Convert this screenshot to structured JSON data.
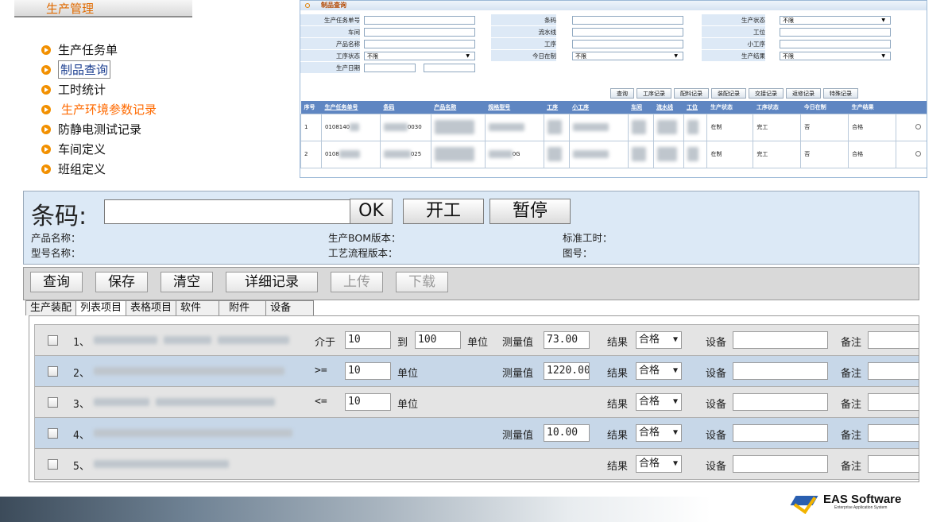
{
  "left_panel": {
    "header": "生产管理",
    "items": [
      {
        "label": "生产任务单"
      },
      {
        "label": "制品查询"
      },
      {
        "label": "工时统计"
      },
      {
        "label": "生产环境参数记录"
      },
      {
        "label": "防静电测试记录"
      },
      {
        "label": "车间定义"
      },
      {
        "label": "班组定义"
      }
    ]
  },
  "query_panel": {
    "title": "制品查询",
    "fields": {
      "task_no": "生产任务单号",
      "workshop": "车间",
      "product_name": "产品名称",
      "process_status": "工序状态",
      "prod_date": "生产日期",
      "barcode": "条码",
      "line": "流水线",
      "process": "工序",
      "today_wip": "今日在制",
      "prod_status": "生产状态",
      "station": "工位",
      "sub_process": "小工序",
      "prod_result": "生产结果"
    },
    "values": {
      "process_status": "不限",
      "today_wip": "不限",
      "prod_status": "不限",
      "prod_result": "不限"
    },
    "buttons": [
      "查询",
      "工序记录",
      "配料记录",
      "装配记录",
      "交接记录",
      "返修记录",
      "特殊记录"
    ],
    "columns": [
      "序号",
      "生产任务单号",
      "条码",
      "产品名称",
      "规格型号",
      "工序",
      "小工序",
      "车间",
      "流水线",
      "工位",
      "生产状态",
      "工序状态",
      "今日在制",
      "生产结果"
    ],
    "rows": [
      {
        "no": "1",
        "task": "0108140",
        "code": "0030",
        "spec": "",
        "wip": "在制",
        "pstat": "完工",
        "today": "否",
        "result": "合格"
      },
      {
        "no": "2",
        "task": "0108",
        "code": "025",
        "spec": "0G",
        "wip": "在制",
        "pstat": "完工",
        "today": "否",
        "result": "合格"
      }
    ]
  },
  "main_form": {
    "barcode_label": "条码:",
    "barcode_value": "",
    "ok_button": "OK",
    "start_button": "开工",
    "pause_button": "暂停",
    "info": {
      "product_name": "产品名称：",
      "model_name": "型号名称：",
      "bom_version": "生产BOM版本：",
      "flow_version": "工艺流程版本：",
      "std_hours": "标准工时：",
      "drawing_no": "图号："
    }
  },
  "toolbar": {
    "query": "查询",
    "save": "保存",
    "clear": "清空",
    "detail": "详细记录",
    "upload": "上传",
    "download": "下载"
  },
  "tabs": [
    "生产装配",
    "列表项目",
    "表格项目",
    "软件",
    "附件",
    "设备"
  ],
  "items": [
    {
      "index": "1、",
      "cond": "介于",
      "lo": "10",
      "to": "到",
      "hi": "100",
      "unit": "单位",
      "meas_label": "测量值",
      "meas": "73.00",
      "res_label": "结果",
      "result": "合格",
      "dev_label": "设备",
      "note_label": "备注"
    },
    {
      "index": "2、",
      "cond": ">=",
      "lo": "10",
      "unit": "单位",
      "meas_label": "测量值",
      "meas": "1220.00",
      "res_label": "结果",
      "result": "合格",
      "dev_label": "设备",
      "note_label": "备注"
    },
    {
      "index": "3、",
      "cond": "<=",
      "lo": "10",
      "unit": "单位",
      "res_label": "结果",
      "result": "合格",
      "dev_label": "设备",
      "note_label": "备注"
    },
    {
      "index": "4、",
      "meas_label": "测量值",
      "meas": "10.00",
      "res_label": "结果",
      "result": "合格",
      "dev_label": "设备",
      "note_label": "备注"
    },
    {
      "index": "5、",
      "res_label": "结果",
      "result": "合格",
      "dev_label": "设备",
      "note_label": "备注"
    }
  ],
  "logo": {
    "name": "EAS Software",
    "sub": "Enterprise Application System"
  },
  "colors": {
    "accent_orange": "#f29000",
    "header_blue": "#5f86c2",
    "panel_blue": "#dce9f6"
  }
}
